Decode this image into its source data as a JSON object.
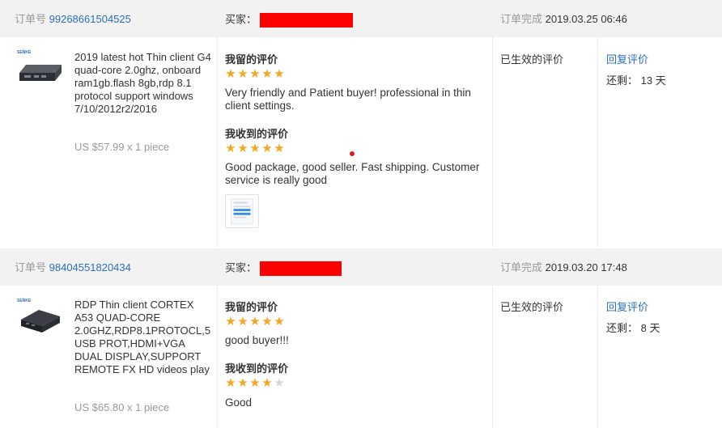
{
  "orders": [
    {
      "order_label": "订单号",
      "order_no": "99268661504525",
      "buyer_label": "买家：",
      "status_label": "订单完成",
      "completed_at": "2019.03.25 06:46",
      "product_title": "2019 latest hot Thin client G4 quad-core 2.0ghz, onboard ram1gb.flash 8gb,rdp 8.1 protocol support windows 7/10/2012r2/2016",
      "price": "US $57.99 x 1 piece",
      "my_review_heading": "我留的评价",
      "my_review_stars": 5,
      "my_review_text": "Very friendly and Patient buyer! professional in thin client settings.",
      "received_review_heading": "我收到的评价",
      "received_review_stars": 5,
      "received_review_text": "Good package, good seller. Fast shipping. Customer service is really good",
      "review_state": "已生效的评价",
      "reply_label": "回复评价",
      "remaining_label": "还剩：",
      "remaining_days": "13 天"
    },
    {
      "order_label": "订单号",
      "order_no": "98404551820434",
      "buyer_label": "买家：",
      "status_label": "订单完成",
      "completed_at": "2019.03.20 17:48",
      "product_title": "RDP Thin client CORTEX A53 QUAD-CORE 2.0GHZ,RDP8.1PROTOCL,5 USB PROT,HDMI+VGA DUAL DISPLAY,SUPPORT REMOTE FX HD videos play",
      "price": "US $65.80 x 1 piece",
      "my_review_heading": "我留的评价",
      "my_review_stars": 5,
      "my_review_text": "good buyer!!!",
      "received_review_heading": "我收到的评价",
      "received_review_stars": 4,
      "received_review_text": "Good",
      "review_state": "已生效的评价",
      "reply_label": "回复评价",
      "remaining_label": "还剩：",
      "remaining_days": "8 天"
    }
  ],
  "star_icon": "star-icon",
  "colors": {
    "star": "#f5a623",
    "link": "#2a6ebb",
    "redaction": "#ff0000",
    "header_bg": "#f2f2f2"
  }
}
